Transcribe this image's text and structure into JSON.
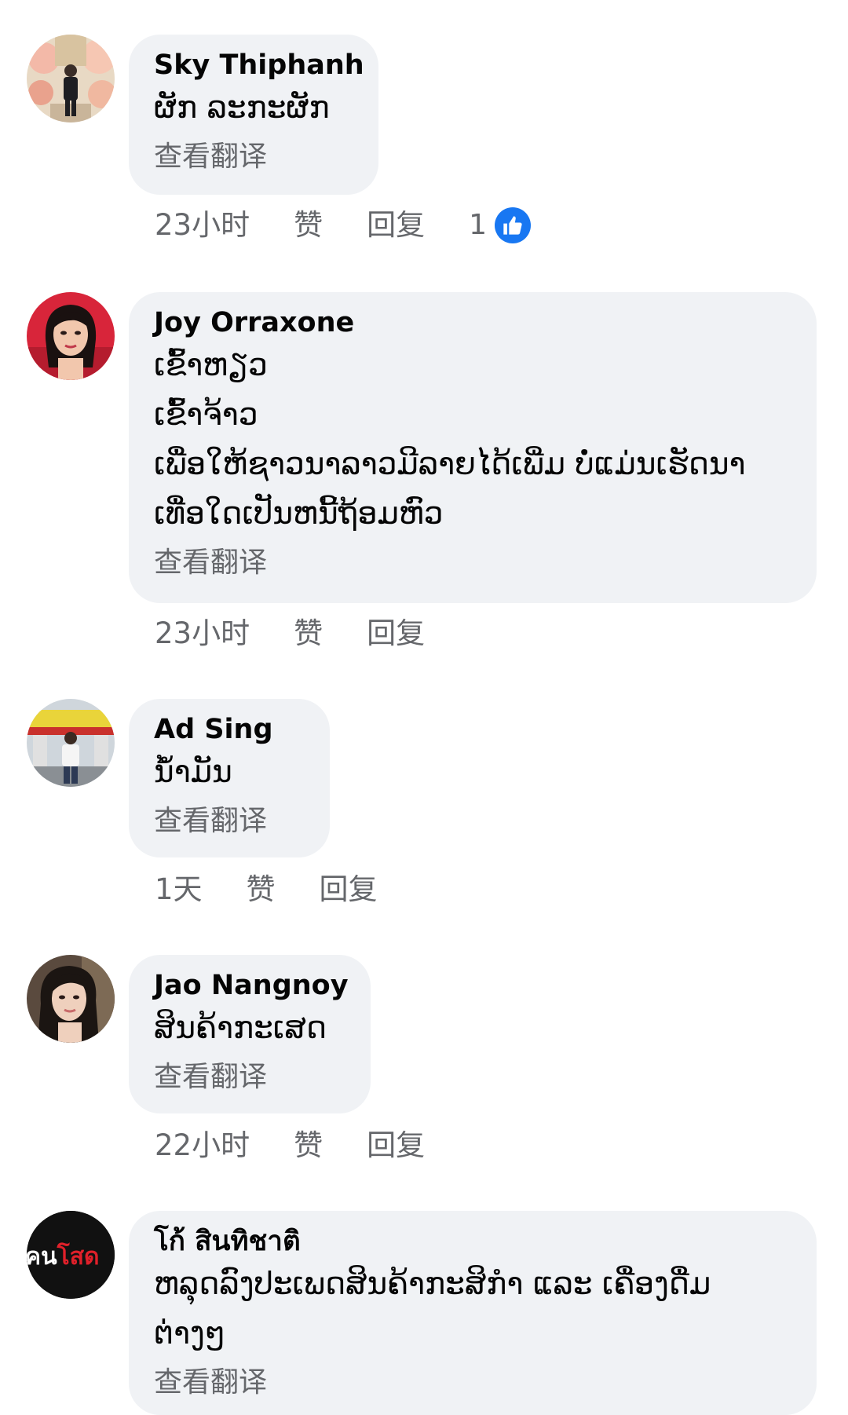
{
  "comments": [
    {
      "author": "Sky Thiphanh",
      "text": "ຜັກ ລະກະຜັກ",
      "translate": "查看翻译",
      "time": "23小时",
      "like": "赞",
      "reply": "回复",
      "reaction_count": "1",
      "avatar_icon": "person-wedding-backdrop-avatar"
    },
    {
      "author": "Joy Orraxone",
      "text": "ເຂົ້າຫຽວ\nເຂົ້າຈ້າວ\nເພື່ອໃຫ້ຊາວນາລາວມີລາຍໄດ້ເພີ່ມ ບໍ່ແມ່ນເຮັດນາ\nເທື່ອໃດເປັນຫນີ້ຖ້ອມຫົວ",
      "translate": "查看翻译",
      "time": "23小时",
      "like": "赞",
      "reply": "回复",
      "avatar_icon": "woman-red-background-avatar"
    },
    {
      "author": "Ad Sing",
      "text": "ນໍ້າມັນ",
      "translate": "查看翻译",
      "time": "1天",
      "like": "赞",
      "reply": "回复",
      "avatar_icon": "man-gas-station-avatar"
    },
    {
      "author": "Jao Nangnoy",
      "text": "ສິນຄ້າກະເສດ",
      "translate": "查看翻译",
      "time": "22小时",
      "like": "赞",
      "reply": "回复",
      "avatar_icon": "woman-selfie-avatar"
    },
    {
      "author": "โก้ สินทิชาติ",
      "text": "ຫລຸດລົງປະເພດສິນຄ້າກະສິກໍາ ແລະ ເຄື່ອງດື່ມ\nຕ່າງໆ",
      "translate": "查看翻译",
      "avatar_logo_text": "คนโสด",
      "avatar_icon": "text-logo-avatar"
    }
  ],
  "colors": {
    "bubble": "#f0f2f5",
    "secondary_text": "#65676b",
    "like_blue": "#1877f2"
  }
}
